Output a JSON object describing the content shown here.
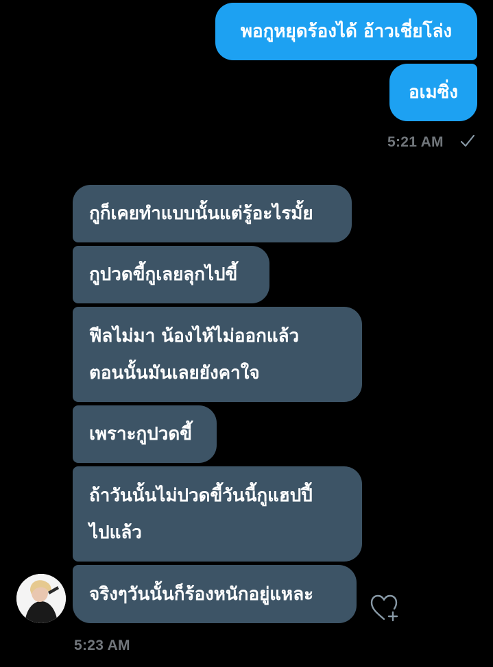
{
  "outgoing": {
    "messages": [
      "พอกูหยุดร้องได้ อ้าวเชี่ยโล่ง",
      "อเมซิ่ง"
    ],
    "timestamp": "5:21 AM",
    "status_icon": "checkmark-icon"
  },
  "incoming": {
    "messages": [
      {
        "lines": [
          "กูก็เคยทำแบบนั้นแต่รู้อะไรมั้ย"
        ]
      },
      {
        "lines": [
          "กูปวดขี้กูเลยลุกไปขี้"
        ]
      },
      {
        "lines": [
          "ฟีลไม่มา น้องไห้ไม่ออกแล้ว",
          "ตอนนั้นมันเลยยังคาใจ"
        ]
      },
      {
        "lines": [
          "เพราะกูปวดขี้"
        ]
      },
      {
        "lines": [
          "ถ้าวันนั้นไม่ปวดขี้วันนี้กูแฮปปี้",
          "ไปแล้ว"
        ]
      },
      {
        "lines": [
          "จริงๆวันนั้นก็ร้องหนักอยู่แหละ"
        ]
      }
    ],
    "timestamp": "5:23 AM",
    "avatar": "avatar",
    "reaction_icon": "heart-plus-icon"
  },
  "colors": {
    "background": "#000000",
    "outgoing_bubble": "#1da1f2",
    "incoming_bubble": "#3d5466",
    "timestamp": "#71767b"
  }
}
